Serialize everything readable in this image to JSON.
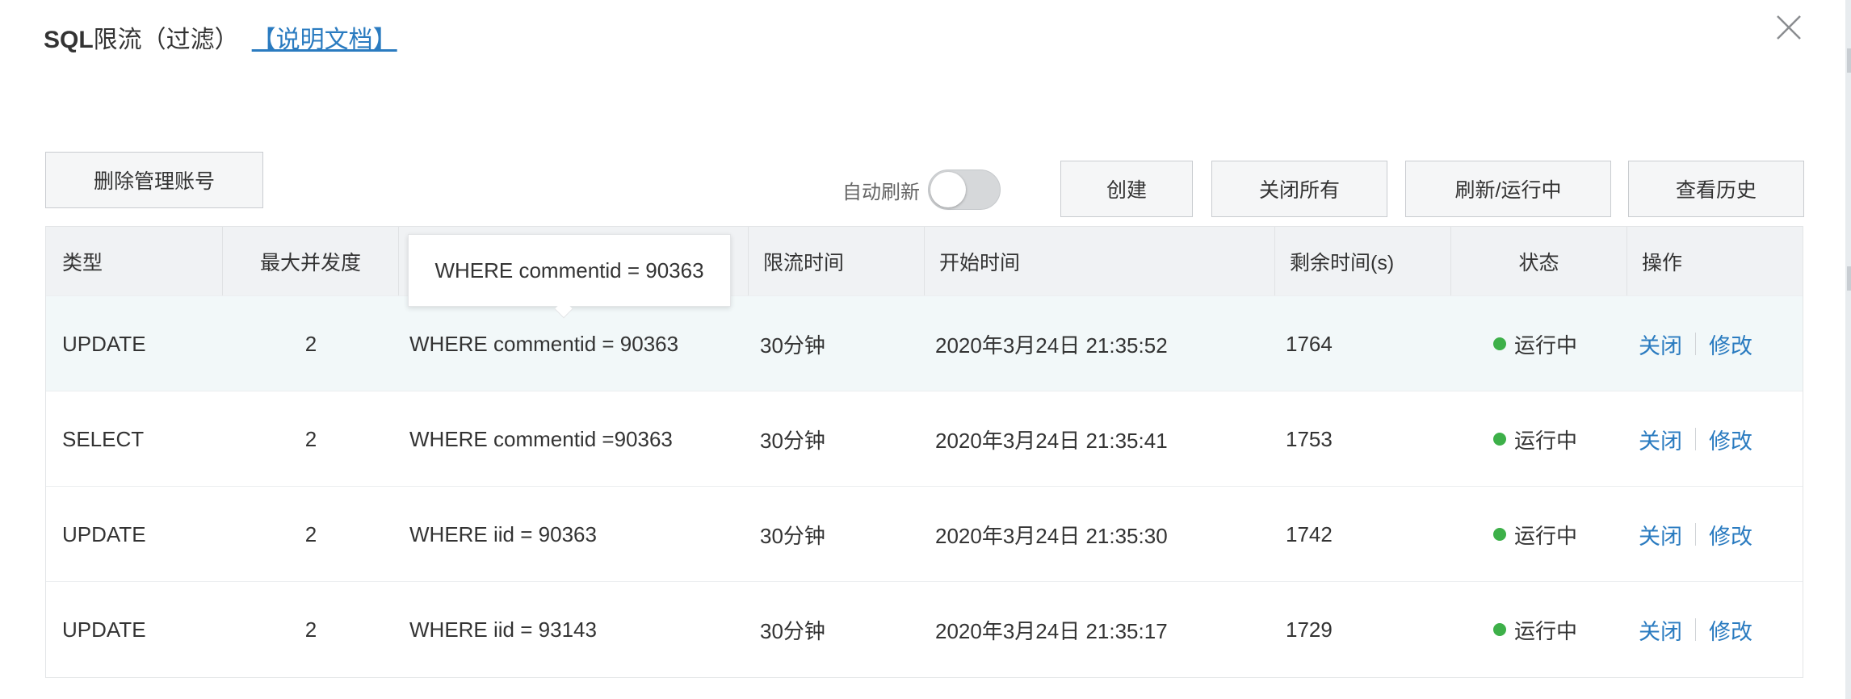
{
  "dialog": {
    "title_prefix": "SQL",
    "title_main": "限流（过滤）",
    "doc_link": "【说明文档】"
  },
  "toolbar": {
    "delete_admin_label": "删除管理账号",
    "auto_refresh_label": "自动刷新",
    "auto_refresh_on": false,
    "create_label": "创建",
    "close_all_label": "关闭所有",
    "refresh_running_label": "刷新/运行中",
    "history_label": "查看历史"
  },
  "table": {
    "headers": {
      "type": "类型",
      "max_concurrency": "最大并发度",
      "limit_time": "限流时间",
      "start_time": "开始时间",
      "remaining": "剩余时间(s)",
      "status": "状态",
      "actions": "操作"
    },
    "rows": [
      {
        "type": "UPDATE",
        "max_concurrency": "2",
        "keyword": "WHERE commentid = 90363",
        "limit_time": "30分钟",
        "start_time": "2020年3月24日 21:35:52",
        "remaining": "1764",
        "status": "运行中",
        "close": "关闭",
        "edit": "修改"
      },
      {
        "type": "SELECT",
        "max_concurrency": "2",
        "keyword": "WHERE commentid =90363",
        "limit_time": "30分钟",
        "start_time": "2020年3月24日 21:35:41",
        "remaining": "1753",
        "status": "运行中",
        "close": "关闭",
        "edit": "修改"
      },
      {
        "type": "UPDATE",
        "max_concurrency": "2",
        "keyword": "WHERE iid = 90363",
        "limit_time": "30分钟",
        "start_time": "2020年3月24日 21:35:30",
        "remaining": "1742",
        "status": "运行中",
        "close": "关闭",
        "edit": "修改"
      },
      {
        "type": "UPDATE",
        "max_concurrency": "2",
        "keyword": "WHERE iid = 93143",
        "limit_time": "30分钟",
        "start_time": "2020年3月24日 21:35:17",
        "remaining": "1729",
        "status": "运行中",
        "close": "关闭",
        "edit": "修改"
      }
    ]
  },
  "tooltip": {
    "text": "WHERE commentid = 90363"
  },
  "colors": {
    "link": "#2a7bc0",
    "status_running": "#3db049",
    "header_bg": "#f0f2f4",
    "hover_row_bg": "#f2f8f9"
  }
}
